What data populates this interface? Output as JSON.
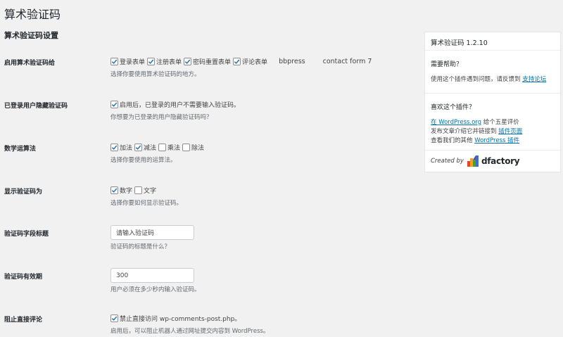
{
  "page": {
    "title": "算术验证码",
    "section_title": "算术验证码设置"
  },
  "rows": {
    "enable": {
      "label": "启用算术验证码给",
      "options": [
        {
          "label": "登录表单",
          "checked": true
        },
        {
          "label": "注册表单",
          "checked": true
        },
        {
          "label": "密码重置表单",
          "checked": true
        },
        {
          "label": "评论表单",
          "checked": true
        },
        {
          "label": "bbpress",
          "checked": false
        },
        {
          "label": "contact form 7",
          "checked": false
        }
      ],
      "desc": "选择你要使用算术验证码的地方。"
    },
    "hide_logged": {
      "label": "已登录用户隐藏验证码",
      "option": "启用后，已登录的用户不需要输入验证码。",
      "desc": "你想要为已登录的用户隐藏验证码吗？"
    },
    "operations": {
      "label": "数学运算法",
      "options": [
        {
          "label": "加法",
          "checked": true
        },
        {
          "label": "减法",
          "checked": true
        },
        {
          "label": "乘法",
          "checked": false
        },
        {
          "label": "除法",
          "checked": false
        }
      ],
      "desc": "选择你要使用的运算法。"
    },
    "display": {
      "label": "显示验证码为",
      "options": [
        {
          "label": "数字",
          "checked": true
        },
        {
          "label": "文字",
          "checked": false
        }
      ],
      "desc": "选择你要如何显示验证码。"
    },
    "field_title": {
      "label": "验证码字段标题",
      "value": "请输入验证码",
      "desc": "验证码的标题是什么？"
    },
    "expiry": {
      "label": "验证码有效期",
      "value": "300",
      "desc": "用户必须在多少秒内输入验证码。"
    },
    "block_direct": {
      "label": "阻止直接评论",
      "option": "禁止直接访问 wp-comments-post.php。",
      "desc": "启用后，可以阻止机器人通过网址提交内容到 WordPress。"
    }
  },
  "sidebar": {
    "title": "算术验证码 1.2.10",
    "help": {
      "heading": "需要帮助？",
      "text": "使用这个插件遇到问题，请反馈到",
      "link": "支持论坛"
    },
    "like": {
      "heading": "喜欢这个插件？",
      "line1_link": "在 WordPress.org",
      "line1_text": " 给个五星评价",
      "line2_text": "发布文章介绍它并链接到 ",
      "line2_link": "插件页面",
      "line3_text": "查看我们的其他 ",
      "line3_link": "WordPress 插件"
    },
    "footer": {
      "created_by": "Created by",
      "brand": "dfactory"
    }
  },
  "colors": {
    "background": "#f1f1f1",
    "link": "#0073aa",
    "text": "#444444"
  }
}
